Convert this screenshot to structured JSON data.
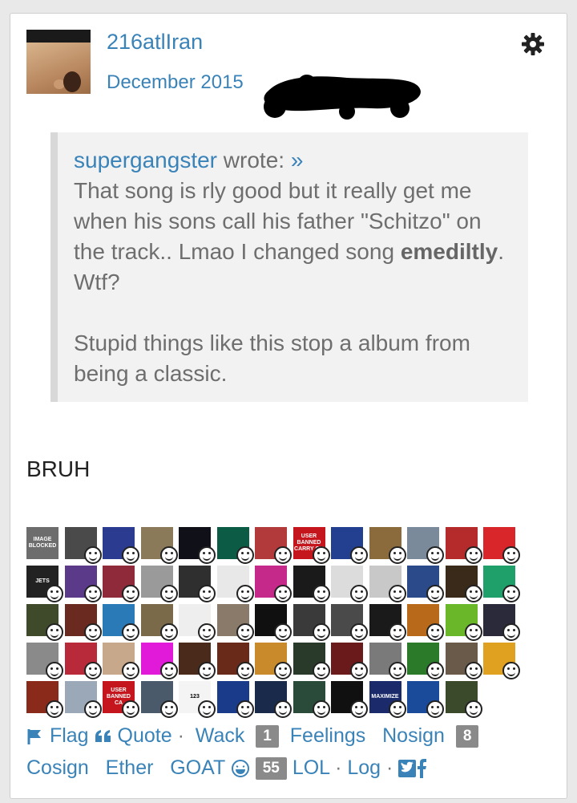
{
  "post": {
    "username": "216atlIran",
    "date": "December 2015",
    "quote": {
      "author": "supergangster",
      "wrote": "wrote:",
      "link": "»",
      "line1": "That song is rly good but it really get me when his sons call his father \"Schitzo\" on the track.. Lmao I changed song",
      "bold_word": "emediltly",
      "line1_end": ". Wtf?",
      "line2": "Stupid things like this stop a album from being a classic."
    },
    "body": "BRUH"
  },
  "reactions": {
    "blocked_label": "IMAGE BLOCKED",
    "banned_label": "USER BANNED CARRY ON",
    "banned_label_2": "USER BANNED CA",
    "maximize_label": "MAXIMIZE",
    "jets_label": "JETS",
    "barcode_number": "123",
    "colors": [
      "#6d6d6d",
      "#4a4a4a",
      "#2b3b8f",
      "#8a7a5a",
      "#101018",
      "#0c5c45",
      "#b23a3a",
      "#c4161c",
      "#22408f",
      "#8b6b3c",
      "#7a8a9a",
      "#b52b2b",
      "#d8262b",
      "#222222",
      "#5b3a8a",
      "#8f2a3b",
      "#9a9a9a",
      "#2f2f2f",
      "#e8e8e8",
      "#c52a8a",
      "#1a1a1a",
      "#dcdcdc",
      "#c8c8c8",
      "#2a4a8a",
      "#3a2a1a",
      "#1fa06a",
      "#3f4a2a",
      "#6a2a20",
      "#2a7ab8",
      "#7a6a4a",
      "#eeeeee",
      "#8a7a6a",
      "#101010",
      "#3a3a3a",
      "#4a4a4a",
      "#1a1a1a",
      "#b86a1a",
      "#6ab82a",
      "#2a2a3a",
      "#8a8a8a",
      "#b82a3a",
      "#c8a88a",
      "#e01ad8",
      "#4a2a1a",
      "#6a2a1a",
      "#c88a2a",
      "#2a3a2a",
      "#6a1a1a",
      "#7a7a7a",
      "#2a7a2a",
      "#6a5a4a",
      "#e0a020",
      "#8a2a1a",
      "#9aa8b8",
      "#c4161c",
      "#4a5a6a",
      "#f4f4f4",
      "#1a3a8a",
      "#1a2a4a",
      "#2a4a3a",
      "#101010",
      "#1a2a6a",
      "#1a4a9a",
      "#3a4a2a"
    ]
  },
  "actions": {
    "flag": "Flag",
    "quote": "Quote",
    "sep1": "·",
    "wack": "Wack",
    "wack_count": "1",
    "feelings": "Feelings",
    "nosign": "Nosign",
    "nosign_count": "8",
    "cosign": "Cosign",
    "ether": "Ether",
    "goat": "GOAT",
    "goat_count": "55",
    "lol": "LOL",
    "sep2": "·",
    "log": "Log",
    "sep3": "·"
  }
}
